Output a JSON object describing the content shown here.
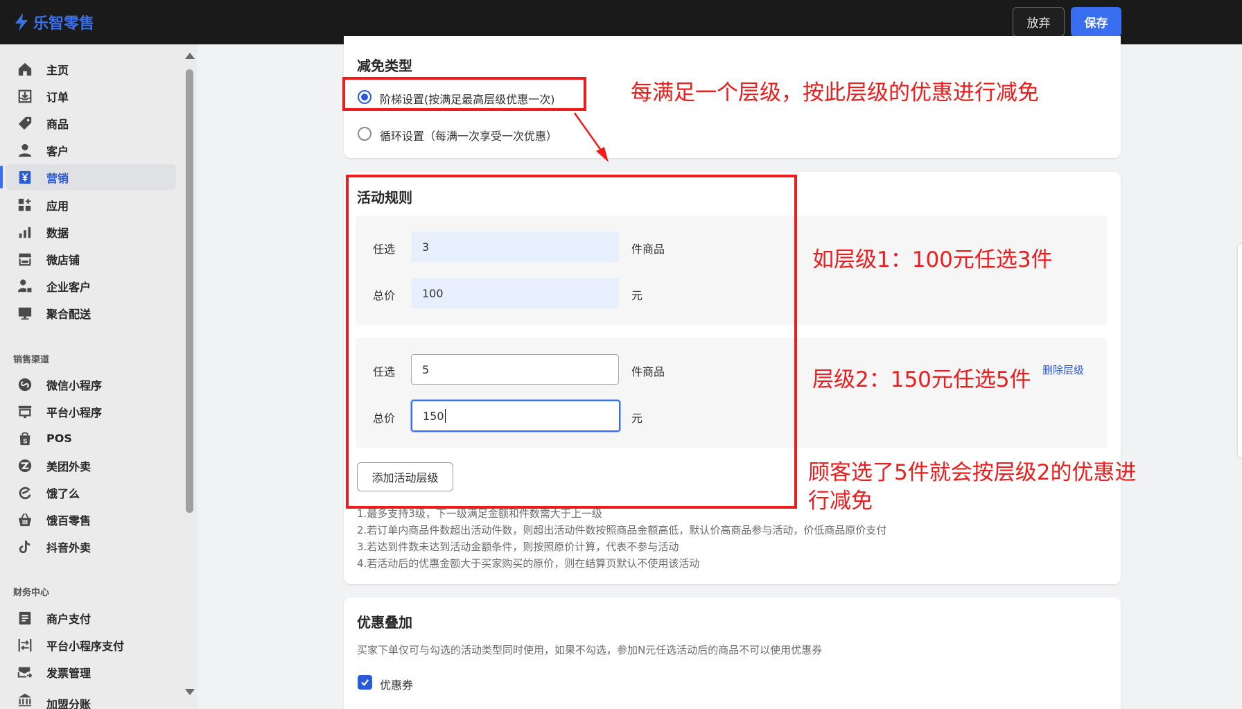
{
  "brand": {
    "name": "乐智零售",
    "color": "#3d6fe8"
  },
  "toolbar": {
    "discard_label": "放弃",
    "save_label": "保存"
  },
  "sidebar": {
    "items": [
      {
        "label": "主页",
        "icon": "home-icon"
      },
      {
        "label": "订单",
        "icon": "order-icon"
      },
      {
        "label": "商品",
        "icon": "tag-icon"
      },
      {
        "label": "客户",
        "icon": "user-icon"
      },
      {
        "label": "营销",
        "icon": "yen-icon",
        "active": true
      },
      {
        "label": "应用",
        "icon": "apps-icon"
      },
      {
        "label": "数据",
        "icon": "bar-chart-icon"
      },
      {
        "label": "微店铺",
        "icon": "store-icon"
      },
      {
        "label": "企业客户",
        "icon": "enterprise-user-icon"
      },
      {
        "label": "聚合配送",
        "icon": "monitor-icon"
      }
    ],
    "sales_channel_title": "销售渠道",
    "sales_channels": [
      {
        "label": "微信小程序",
        "icon": "mini-program-icon"
      },
      {
        "label": "平台小程序",
        "icon": "platform-icon"
      },
      {
        "label": "POS",
        "icon": "pos-bag-icon"
      },
      {
        "label": "美团外卖",
        "icon": "meituan-icon"
      },
      {
        "label": "饿了么",
        "icon": "eleme-icon"
      },
      {
        "label": "饿百零售",
        "icon": "basket-icon"
      },
      {
        "label": "抖音外卖",
        "icon": "douyin-icon"
      }
    ],
    "finance_title": "财务中心",
    "finance": [
      {
        "label": "商户支付",
        "icon": "ledger-icon"
      },
      {
        "label": "平台小程序支付",
        "icon": "transfer-icon"
      },
      {
        "label": "发票管理",
        "icon": "invoice-icon"
      },
      {
        "label": "加盟分账",
        "icon": "bank-icon"
      }
    ]
  },
  "discount_type": {
    "title": "减免类型",
    "options": [
      {
        "label": "阶梯设置(按满足最高层级优惠一次)",
        "checked": true
      },
      {
        "label": "循环设置（每满一次享受一次优惠）",
        "checked": false
      }
    ]
  },
  "rules": {
    "title": "活动规则",
    "tiers": [
      {
        "qty_label": "任选",
        "qty_value": "3",
        "qty_unit": "件商品",
        "price_label": "总价",
        "price_value": "100",
        "price_unit": "元"
      },
      {
        "qty_label": "任选",
        "qty_value": "5",
        "qty_unit": "件商品",
        "price_label": "总价",
        "price_value": "150",
        "price_unit": "元",
        "delete_label": "删除层级"
      }
    ],
    "add_tier_label": "添加活动层级",
    "notes": [
      "1.最多支持3级，下一级满足金额和件数需大于上一级",
      "2.若订单内商品件数超出活动件数，则超出活动件数按照商品金额高低，默认价高商品参与活动，价低商品原价支付",
      "3.若达到件数未达到活动金额条件，则按照原价计算，代表不参与活动",
      "4.若活动后的优惠金额大于买家购买的原价，则在结算页默认不使用该活动"
    ]
  },
  "stacking": {
    "title": "优惠叠加",
    "description": "买家下单仅可与勾选的活动类型同时使用，如果不勾选，参加N元任选活动后的商品不可以使用优惠券",
    "option_label": "优惠券",
    "option_checked": true
  },
  "annotations": {
    "color": "#ee1c1c",
    "a1": "每满足一个层级，按此层级的优惠进行减免",
    "a2": "如层级1：100元任选3件",
    "a3": "层级2：150元任选5件",
    "a4_line1": "顾客选了5件就会按层级2的优惠进",
    "a4_line2": "行减免"
  }
}
